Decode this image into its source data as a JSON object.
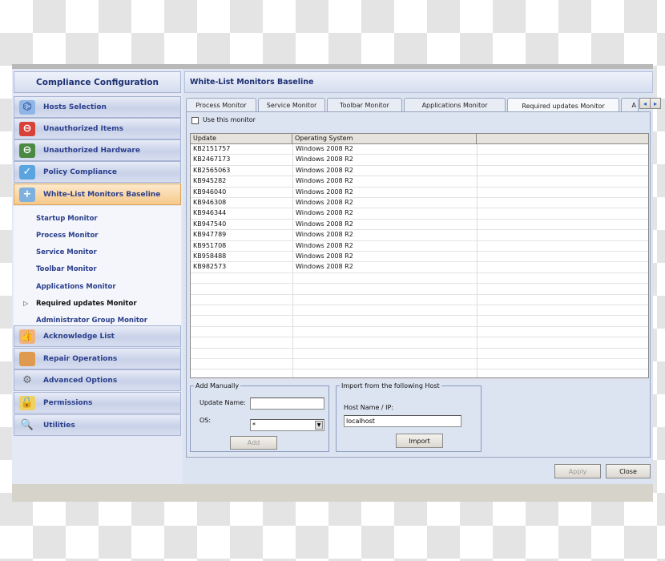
{
  "sidebar": {
    "title": "Compliance Configuration",
    "items": [
      {
        "label": "Hosts Selection",
        "icon": "network-hosts-icon"
      },
      {
        "label": "Unauthorized Items",
        "icon": "computer-blocked-icon"
      },
      {
        "label": "Unauthorized Hardware",
        "icon": "hardware-blocked-icon"
      },
      {
        "label": "Policy Compliance",
        "icon": "checklist-ok-icon"
      },
      {
        "label": "White-List Monitors Baseline",
        "icon": "monitor-add-icon",
        "selected": true
      }
    ],
    "subitems": [
      "Startup Monitor",
      "Process Monitor",
      "Service Monitor",
      "Toolbar Monitor",
      "Applications Monitor",
      "Required updates Monitor",
      "Administrator Group Monitor"
    ],
    "current_subitem": "Required updates Monitor",
    "items_bottom": [
      {
        "label": "Acknowledge List",
        "icon": "thumbs-up-icon"
      },
      {
        "label": "Repair Operations",
        "icon": "bandage-icon"
      },
      {
        "label": "Advanced Options",
        "icon": "gear-icon"
      },
      {
        "label": "Permissions",
        "icon": "lock-icon"
      },
      {
        "label": "Utilities",
        "icon": "magnifier-tools-icon"
      }
    ]
  },
  "main": {
    "title": "White-List Monitors Baseline",
    "tabs": [
      "Process Monitor",
      "Service Monitor",
      "Toolbar Monitor",
      "Applications Monitor",
      "Required updates Monitor",
      "A"
    ],
    "active_tab": "Required updates Monitor",
    "use_monitor_label": "Use this monitor",
    "use_monitor_checked": false,
    "table": {
      "columns": [
        "Update",
        "Operating System",
        ""
      ],
      "rows": [
        [
          "KB2151757",
          "Windows 2008 R2"
        ],
        [
          "KB2467173",
          "Windows 2008 R2"
        ],
        [
          "KB2565063",
          "Windows 2008 R2"
        ],
        [
          "KB945282",
          "Windows 2008 R2"
        ],
        [
          "KB946040",
          "Windows 2008 R2"
        ],
        [
          "KB946308",
          "Windows 2008 R2"
        ],
        [
          "KB946344",
          "Windows 2008 R2"
        ],
        [
          "KB947540",
          "Windows 2008 R2"
        ],
        [
          "KB947789",
          "Windows 2008 R2"
        ],
        [
          "KB951708",
          "Windows 2008 R2"
        ],
        [
          "KB958488",
          "Windows 2008 R2"
        ],
        [
          "KB982573",
          "Windows 2008 R2"
        ]
      ]
    },
    "add_manually": {
      "legend": "Add Manually",
      "update_name_label": "Update Name:",
      "update_name_value": "",
      "os_label": "OS:",
      "os_value": "*",
      "add_label": "Add"
    },
    "import": {
      "legend": "Import from the following Host",
      "host_label": "Host Name / IP:",
      "host_value": "localhost",
      "import_label": "Import"
    },
    "apply_label": "Apply",
    "close_label": "Close"
  }
}
